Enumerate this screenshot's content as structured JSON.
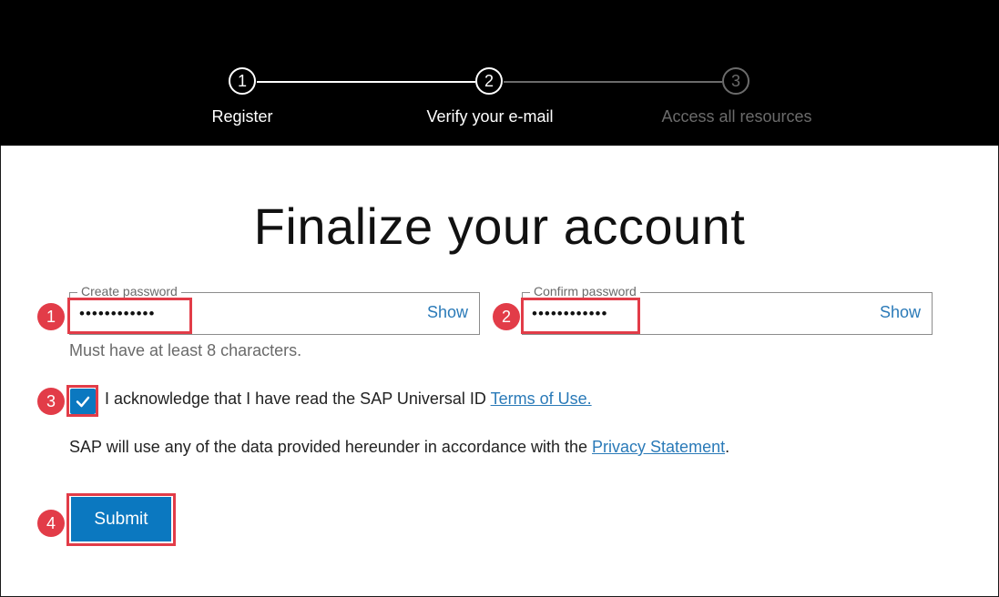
{
  "stepper": {
    "steps": [
      {
        "number": "1",
        "label": "Register",
        "state": "complete"
      },
      {
        "number": "2",
        "label": "Verify your e-mail",
        "state": "current"
      },
      {
        "number": "3",
        "label": "Access all resources",
        "state": "inactive"
      }
    ]
  },
  "title": "Finalize your account",
  "create_password": {
    "legend": "Create password",
    "value": "••••••••••••",
    "show_label": "Show"
  },
  "confirm_password": {
    "legend": "Confirm password",
    "value": "••••••••••••",
    "show_label": "Show"
  },
  "password_hint": "Must have at least 8 characters.",
  "acknowledge": {
    "checked": true,
    "text": "I acknowledge that I have read the SAP Universal ID ",
    "link_label": "Terms of Use."
  },
  "privacy": {
    "text": "SAP will use any of the data provided hereunder in accordance with the ",
    "link_label": "Privacy Statement",
    "suffix": "."
  },
  "submit_label": "Submit",
  "annotations": [
    "1",
    "2",
    "3",
    "4"
  ],
  "colors": {
    "accent": "#0b78c0",
    "link": "#2a7ab8",
    "highlight": "#e23c48",
    "header_bg": "#000000",
    "inactive_step": "#6b6b6b"
  },
  "icons": {
    "checkbox": "check-icon"
  }
}
